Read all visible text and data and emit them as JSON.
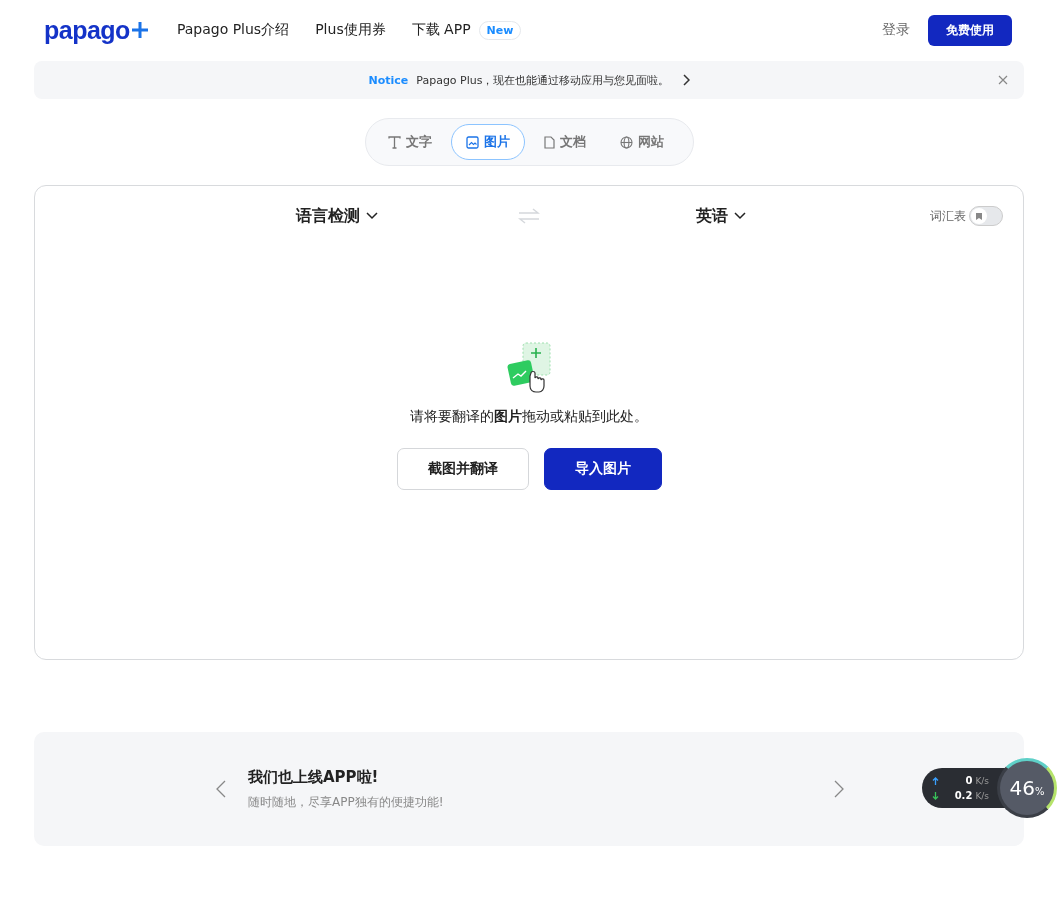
{
  "header": {
    "logo": "papago",
    "nav": [
      {
        "label": "Papago Plus介绍"
      },
      {
        "label": "Plus使用券"
      },
      {
        "label": "下载 APP",
        "badge": "New"
      }
    ],
    "login": "登录",
    "cta": "免费使用"
  },
  "notice": {
    "tag": "Notice",
    "text": "Papago Plus，现在也能通过移动应用与您见面啦。"
  },
  "tabs": [
    {
      "kind": "text",
      "label": "文字",
      "selected": false
    },
    {
      "kind": "image",
      "label": "图片",
      "selected": true
    },
    {
      "kind": "document",
      "label": "文档",
      "selected": false
    },
    {
      "kind": "web",
      "label": "网站",
      "selected": false
    }
  ],
  "translator": {
    "source": "语言检测",
    "target": "英语",
    "glossary": {
      "label": "词汇表",
      "on": false
    },
    "prompt": "请将要翻译的**图片**拖动或粘贴到此处。",
    "buttons": [
      {
        "kind": "secondary",
        "label": "截图并翻译"
      },
      {
        "kind": "primary",
        "label": "导入图片"
      }
    ]
  },
  "banner": {
    "title": "我们也上线APP啦!",
    "subtitle": "随时随地，尽享APP独有的便捷功能!"
  },
  "speed_widget": {
    "up": "0",
    "up_unit": "K/s",
    "down": "0.2",
    "down_unit": "K/s",
    "percent": "46",
    "percent_sign": "%"
  }
}
